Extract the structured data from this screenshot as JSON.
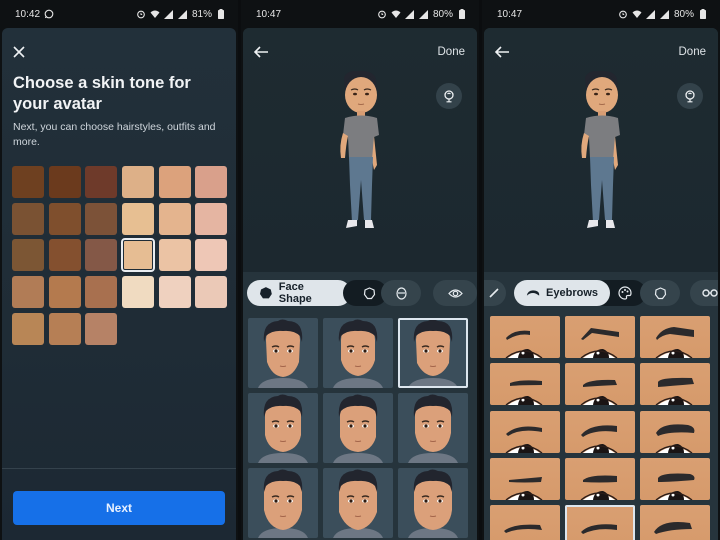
{
  "screens": [
    {
      "status": {
        "time": "10:42",
        "battery": "81%",
        "icons": [
          "whatsapp-icon",
          "alarm-icon",
          "wifi-icon",
          "signal-icon",
          "signal-icon",
          "battery-icon"
        ]
      },
      "title": "Choose a skin tone for your avatar",
      "subtitle": "Next, you can choose hairstyles, outfits and more.",
      "close_icon": "close-icon",
      "skin_tones": [
        "#6e4020",
        "#6b3a1d",
        "#6e3a2a",
        "#ddb088",
        "#dca27c",
        "#d9a08b",
        "#7a5233",
        "#7f4f2d",
        "#7c5238",
        "#e7bf92",
        "#e4b48e",
        "#e5b5a2",
        "#7c5634",
        "#84502f",
        "#845847",
        "#e6bd93",
        "#ebc3a4",
        "#eec7b6",
        "#b17c56",
        "#b47a4e",
        "#a8704f",
        "#f0dbc1",
        "#efd1bf",
        "#ebc9b7",
        "#b88656",
        "#b67f55",
        "#b68266"
      ],
      "selected_tone_index": 15,
      "next_label": "Next"
    },
    {
      "status": {
        "time": "10:47",
        "battery": "80%",
        "icons": [
          "alarm-icon",
          "wifi-icon",
          "signal-icon",
          "signal-icon",
          "battery-icon"
        ]
      },
      "back_icon": "back-arrow-icon",
      "done_label": "Done",
      "mirror_icon": "mirror-icon",
      "tabs": [
        {
          "label": "Face Shape",
          "icon": "face-shape-icon",
          "active": true
        },
        {
          "label": "",
          "icon": "head-outline-icon",
          "active": false
        },
        {
          "label": "",
          "icon": "face-detail-icon",
          "active": false
        },
        {
          "label": "",
          "icon": "eye-icon",
          "active": false
        }
      ],
      "face_options_count": 9,
      "selected_face_index": 2
    },
    {
      "status": {
        "time": "10:47",
        "battery": "80%",
        "icons": [
          "alarm-icon",
          "wifi-icon",
          "signal-icon",
          "signal-icon",
          "battery-icon"
        ]
      },
      "back_icon": "back-arrow-icon",
      "done_label": "Done",
      "mirror_icon": "mirror-icon",
      "tabs": [
        {
          "label": "",
          "icon": "brush-icon",
          "active": false
        },
        {
          "label": "Eyebrows",
          "icon": "eyebrow-icon",
          "active": true
        },
        {
          "label": "",
          "icon": "palette-icon",
          "active": false
        },
        {
          "label": "",
          "icon": "head-outline-icon",
          "active": false
        },
        {
          "label": "",
          "icon": "glasses-icon",
          "active": false
        }
      ],
      "eyebrow_options_count": 15,
      "selected_eyebrow_index": 13
    }
  ]
}
